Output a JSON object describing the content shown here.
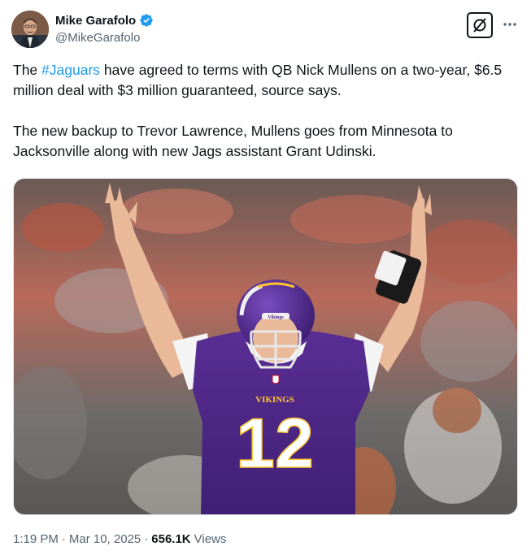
{
  "author": {
    "name": "Mike Garafolo",
    "handle": "@MikeGarafolo",
    "verified": true,
    "verified_color": "#1d9bf0"
  },
  "tweet": {
    "p1_prefix": "The ",
    "p1_hashtag": "#Jaguars",
    "p1_suffix": " have agreed to terms with QB Nick Mullens on a two-year, $6.5 million deal with $3 million guaranteed, source says.",
    "p2": "The new backup to Trevor Lawrence, Mullens goes from Minnesota to Jacksonville along with new Jags assistant Grant Udinski."
  },
  "media": {
    "jersey_number": "12",
    "jersey_wordmark": "VIKINGS",
    "helmet_wordmark": "Vikings",
    "jersey_color": "#4f2683",
    "accent_color": "#ffc62f"
  },
  "meta": {
    "time": "1:19 PM",
    "sep1": "·",
    "date": "Mar 10, 2025",
    "sep2": "·",
    "views_count": "656.1K",
    "views_label": "Views"
  },
  "icons": {
    "grok": "grok-icon",
    "more": "more-icon",
    "verified": "verified-badge-icon"
  }
}
